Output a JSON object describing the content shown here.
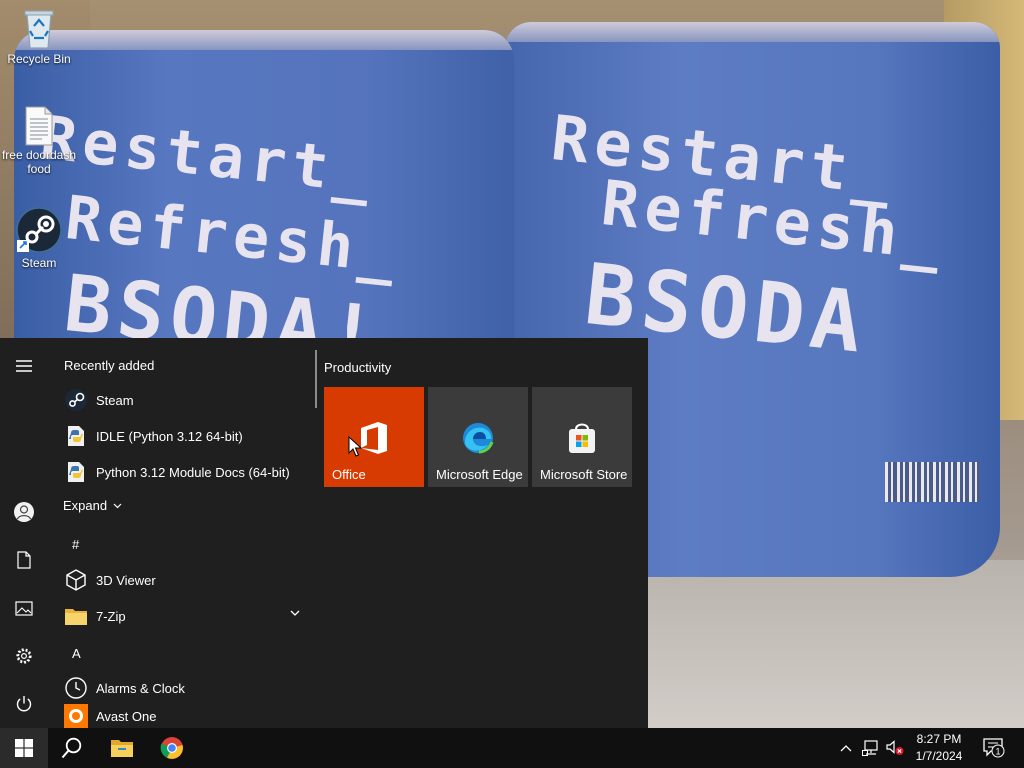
{
  "desktop": {
    "icons": [
      {
        "label": "Recycle Bin",
        "icon": "recycle-bin-icon"
      },
      {
        "label": "free doordash food",
        "icon": "text-file-icon"
      },
      {
        "label": "Steam",
        "icon": "steam-icon"
      }
    ],
    "wallpaper": {
      "cup_text_line1": "Restart_",
      "cup_text_line2": "Refresh_",
      "cup_text_line3": "BSODA!",
      "cup_right_line3": "BSODA"
    }
  },
  "start_menu": {
    "rail": [
      "hamburger-menu-icon",
      "user-account-icon",
      "documents-icon",
      "pictures-icon",
      "settings-icon",
      "power-icon"
    ],
    "recently_added_title": "Recently added",
    "recent_apps": [
      {
        "label": "Steam",
        "icon": "steam-icon"
      },
      {
        "label": "IDLE (Python 3.12 64-bit)",
        "icon": "python-icon"
      },
      {
        "label": "Python 3.12 Module Docs (64-bit)",
        "icon": "python-docs-icon"
      }
    ],
    "expand_label": "Expand",
    "hash_letter": "#",
    "hash_apps": [
      {
        "label": "3D Viewer",
        "icon": "3d-viewer-icon"
      },
      {
        "label": "7-Zip",
        "icon": "folder-icon",
        "expandable": true
      }
    ],
    "a_letter": "A",
    "a_apps": [
      {
        "label": "Alarms & Clock",
        "icon": "alarm-clock-icon"
      },
      {
        "label": "Avast One",
        "icon": "avast-icon"
      }
    ],
    "tiles_group_title": "Productivity",
    "tiles": [
      {
        "label": "Office",
        "icon": "office-icon",
        "color": "#d83b01"
      },
      {
        "label": "Microsoft Edge",
        "icon": "edge-icon",
        "color": "#3b3b3b"
      },
      {
        "label": "Microsoft Store",
        "icon": "store-icon",
        "color": "#3b3b3b"
      }
    ]
  },
  "taskbar": {
    "pinned": [
      "windows-start-icon",
      "search-icon",
      "file-explorer-icon",
      "chrome-icon"
    ],
    "tray": [
      "show-hidden-icons-chevron",
      "network-icon",
      "volume-muted-icon"
    ],
    "time": "8:27 PM",
    "date": "1/7/2024",
    "notification_count": "1"
  }
}
